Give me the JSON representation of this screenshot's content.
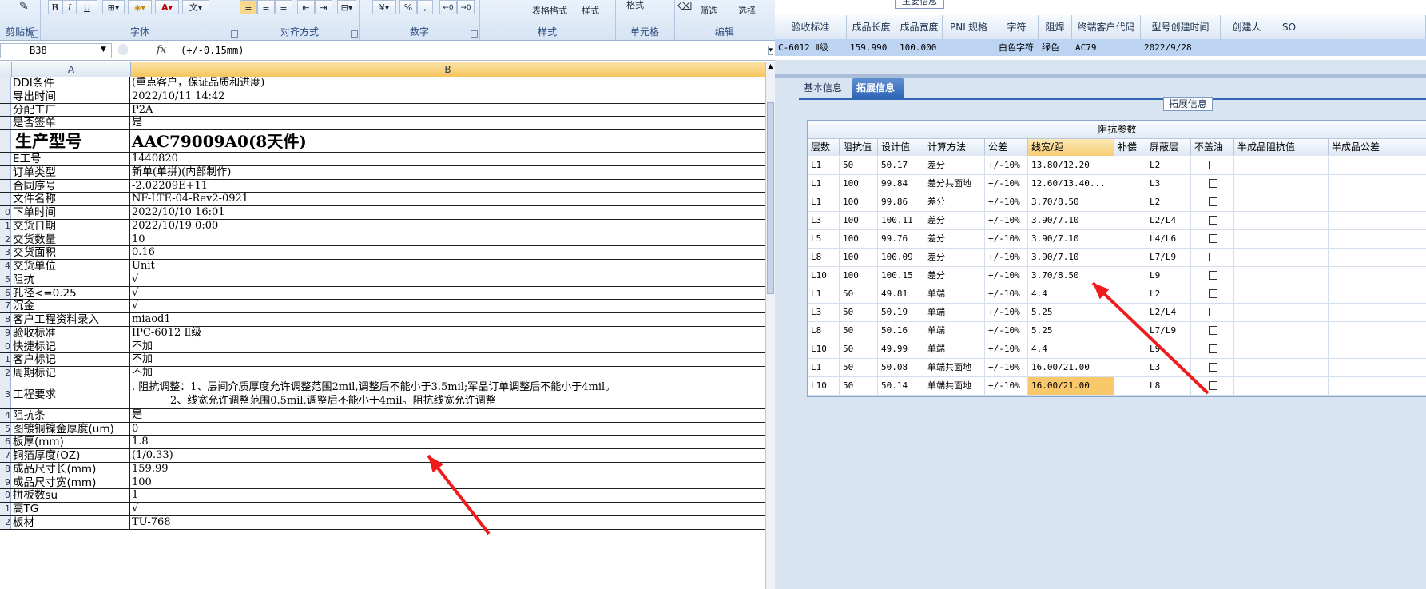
{
  "ribbon": {
    "groups": [
      "剪贴板",
      "字体",
      "对齐方式",
      "数字",
      "样式",
      "单元格",
      "编辑"
    ],
    "font_buttons": [
      "B",
      "I",
      "U"
    ],
    "number_buttons": [
      "%",
      ","
    ],
    "style_items": [
      "表格格式",
      "样式"
    ],
    "cell_items": [
      "格式"
    ],
    "edit_items": [
      "筛选",
      "选择"
    ]
  },
  "formula_bar": {
    "name_box": "B38",
    "fx": "fx",
    "formula": "(+/-0.15mm)"
  },
  "sheet": {
    "columns": [
      "A",
      "B"
    ],
    "rows": [
      {
        "num": "",
        "label": "DDI条件",
        "value": "(重点客户，保证品质和进度)"
      },
      {
        "num": "",
        "label": "导出时间",
        "value": "2022/10/11 14:42"
      },
      {
        "num": "",
        "label": "分配工厂",
        "value": "P2A"
      },
      {
        "num": "",
        "label": "是否签单",
        "value": "是"
      },
      {
        "num": "",
        "label": "生产型号",
        "value": "AAC79009A0(8天件)",
        "big": true
      },
      {
        "num": "",
        "label": "E工号",
        "value": "1440820"
      },
      {
        "num": "",
        "label": "订单类型",
        "value": "新单(单拼)(内部制作)"
      },
      {
        "num": "",
        "label": "合同序号",
        "value": "-2.02209E+11"
      },
      {
        "num": "",
        "label": "文件名称",
        "value": "NF-LTE-04-Rev2-0921"
      },
      {
        "num": "0",
        "label": "下单时间",
        "value": "2022/10/10 16:01"
      },
      {
        "num": "1",
        "label": "交货日期",
        "value": "2022/10/19 0:00"
      },
      {
        "num": "2",
        "label": "交货数量",
        "value": "10"
      },
      {
        "num": "3",
        "label": "交货面积",
        "value": "0.16"
      },
      {
        "num": "4",
        "label": "交货单位",
        "value": "Unit"
      },
      {
        "num": "5",
        "label": "阻抗",
        "value": "√"
      },
      {
        "num": "6",
        "label": "孔径<=0.25",
        "value": "√"
      },
      {
        "num": "7",
        "label": "沉金",
        "value": "√"
      },
      {
        "num": "8",
        "label": "客户工程资料录入",
        "value": "miaod1"
      },
      {
        "num": "9",
        "label": "验收标准",
        "value": "IPC-6012 Ⅱ级"
      },
      {
        "num": "0",
        "label": "快捷标记",
        "value": "不加"
      },
      {
        "num": "1",
        "label": "客户标记",
        "value": "不加"
      },
      {
        "num": "2",
        "label": "周期标记",
        "value": "不加"
      },
      {
        "num": "3",
        "label": "工程要求",
        "value": ". 阻抗调整：1、层间介质厚度允许调整范围2mil,调整后不能小于3.5mil;军品订单调整后不能小于4mil。",
        "value2": "2、线宽允许调整范围0.5mil,调整后不能小于4mil。阻抗线宽允许调整",
        "tall": true
      },
      {
        "num": "4",
        "label": "阻抗条",
        "value": "是"
      },
      {
        "num": "5",
        "label": "图镀铜镍金厚度(um)",
        "value": "0"
      },
      {
        "num": "6",
        "label": "板厚(mm)",
        "value": "1.8"
      },
      {
        "num": "7",
        "label": "铜箔厚度(OZ)",
        "value": "(1/0.33)"
      },
      {
        "num": "8",
        "label": "成品尺寸长(mm)",
        "value": "159.99"
      },
      {
        "num": "9",
        "label": "成品尺寸宽(mm)",
        "value": "100"
      },
      {
        "num": "0",
        "label": "拼板数su",
        "value": "1"
      },
      {
        "num": "1",
        "label": "高TG",
        "value": "√"
      },
      {
        "num": "2",
        "label": "板材",
        "value": "TU-768"
      }
    ]
  },
  "app": {
    "main_info_title": "主要信息",
    "top_table": {
      "headers": [
        "验收标准",
        "成品长度",
        "成品宽度",
        "PNL规格",
        "字符",
        "阻焊",
        "终端客户代码",
        "型号创建时间",
        "创建人",
        "SO"
      ],
      "row": [
        "C-6012 Ⅱ级",
        "159.990",
        "100.000",
        "",
        "白色字符",
        "绿色",
        "AC79",
        "2022/9/28",
        "",
        ""
      ]
    },
    "tabs": [
      "基本信息",
      "拓展信息"
    ],
    "active_tab": "拓展信息",
    "ext_title": "拓展信息",
    "impedance": {
      "caption": "阻抗参数",
      "headers": [
        "层数",
        "阻抗值",
        "设计值",
        "计算方法",
        "公差",
        "线宽/距",
        "补偿",
        "屏蔽层",
        "不盖油",
        "半成品阻抗值",
        "半成品公差"
      ],
      "rows": [
        [
          "L1",
          "50",
          "50.17",
          "差分",
          "+/-10%",
          "13.80/12.20",
          "",
          "L2"
        ],
        [
          "L1",
          "100",
          "99.84",
          "差分共面地",
          "+/-10%",
          "12.60/13.40...",
          "",
          "L3"
        ],
        [
          "L1",
          "100",
          "99.86",
          "差分",
          "+/-10%",
          "3.70/8.50",
          "",
          "L2"
        ],
        [
          "L3",
          "100",
          "100.11",
          "差分",
          "+/-10%",
          "3.90/7.10",
          "",
          "L2/L4"
        ],
        [
          "L5",
          "100",
          "99.76",
          "差分",
          "+/-10%",
          "3.90/7.10",
          "",
          "L4/L6"
        ],
        [
          "L8",
          "100",
          "100.09",
          "差分",
          "+/-10%",
          "3.90/7.10",
          "",
          "L7/L9"
        ],
        [
          "L10",
          "100",
          "100.15",
          "差分",
          "+/-10%",
          "3.70/8.50",
          "",
          "L9"
        ],
        [
          "L1",
          "50",
          "49.81",
          "单端",
          "+/-10%",
          "4.4",
          "",
          "L2"
        ],
        [
          "L3",
          "50",
          "50.19",
          "单端",
          "+/-10%",
          "5.25",
          "",
          "L2/L4"
        ],
        [
          "L8",
          "50",
          "50.16",
          "单端",
          "+/-10%",
          "5.25",
          "",
          "L7/L9"
        ],
        [
          "L10",
          "50",
          "49.99",
          "单端",
          "+/-10%",
          "4.4",
          "",
          "L9"
        ],
        [
          "L1",
          "50",
          "50.08",
          "单端共面地",
          "+/-10%",
          "16.00/21.00",
          "",
          "L3"
        ],
        [
          "L10",
          "50",
          "50.14",
          "单端共面地",
          "+/-10%",
          "16.00/21.00",
          "",
          "L8"
        ]
      ]
    }
  },
  "annotations": {
    "arrow_color": "#ee1c1c"
  }
}
